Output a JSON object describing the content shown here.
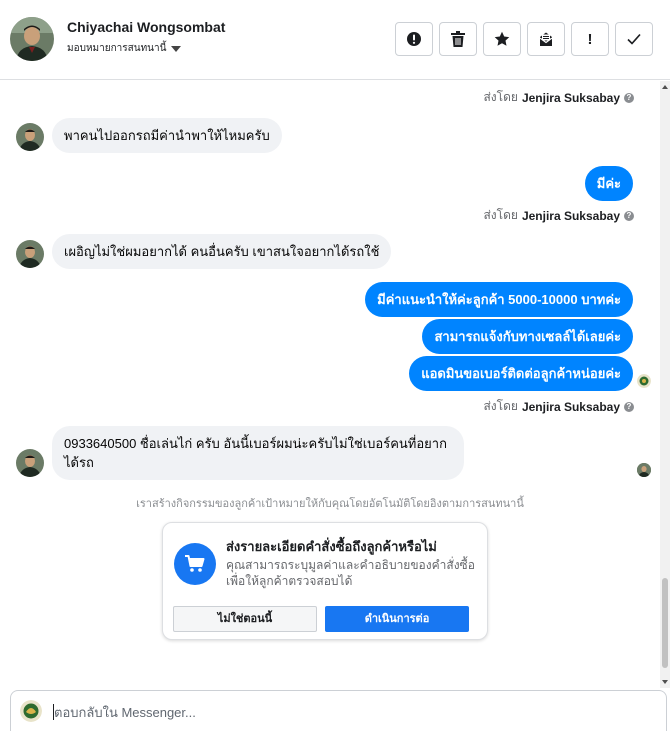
{
  "header": {
    "name": "Chiyachai Wongsombat",
    "assign_label": "มอบหมายการสนทนานี้"
  },
  "actions": [
    {
      "name": "spam-button",
      "icon": "alert-circle-icon"
    },
    {
      "name": "delete-button",
      "icon": "trash-icon"
    },
    {
      "name": "star-button",
      "icon": "star-icon"
    },
    {
      "name": "mark-unread-button",
      "icon": "envelope-icon"
    },
    {
      "name": "follow-up-button",
      "icon": "exclamation-icon",
      "label": "!"
    },
    {
      "name": "done-button",
      "icon": "check-icon"
    }
  ],
  "sent_by_prefix": "ส่งโดย",
  "agent_name": "Jenjira Suksabay",
  "messages": {
    "in1": "พาคนไปออกรถมีค่านำพาให้ไหมครับ",
    "out1": "มีค่ะ",
    "in2": "เผอิญไม่ใช่ผมอยากได้ คนอื่นครับ เขาสนใจอยากได้รถใช้",
    "out2": "มีค่าแนะนำให้ค่ะลูกค้า 5000-10000 บาทค่ะ",
    "out3": "สามารถแจ้งกับทางเซลล์ได้เลยค่ะ",
    "out4": "แอดมินขอเบอร์ติดต่อลูกค้าหน่อยค่ะ",
    "in3": "0933640500 ชื่อเล่นไก่ ครับ อันนี้เบอร์ผมน่ะครับไม่ใช่เบอร์คนที่อยากได้รถ"
  },
  "system_note": "เราสร้างกิจกรรมของลูกค้าเป้าหมายให้กับคุณโดยอัตโนมัติโดยอิงตามการสนทนานี้",
  "order_card": {
    "title": "ส่งรายละเอียดคำสั่งซื้อถึงลูกค้าหรือไม่",
    "description": "คุณสามารถระบุมูลค่าและคำอธิบายของคำสั่งซื้อเพื่อให้ลูกค้าตรวจสอบได้",
    "decline_label": "ไม่ใช่ตอนนี้",
    "continue_label": "ดำเนินการต่อ"
  },
  "composer": {
    "placeholder": "ตอบกลับใน Messenger..."
  },
  "colors": {
    "outgoing_bubble": "#0084ff",
    "incoming_bubble": "#f0f2f5",
    "primary_button": "#1877f2"
  }
}
